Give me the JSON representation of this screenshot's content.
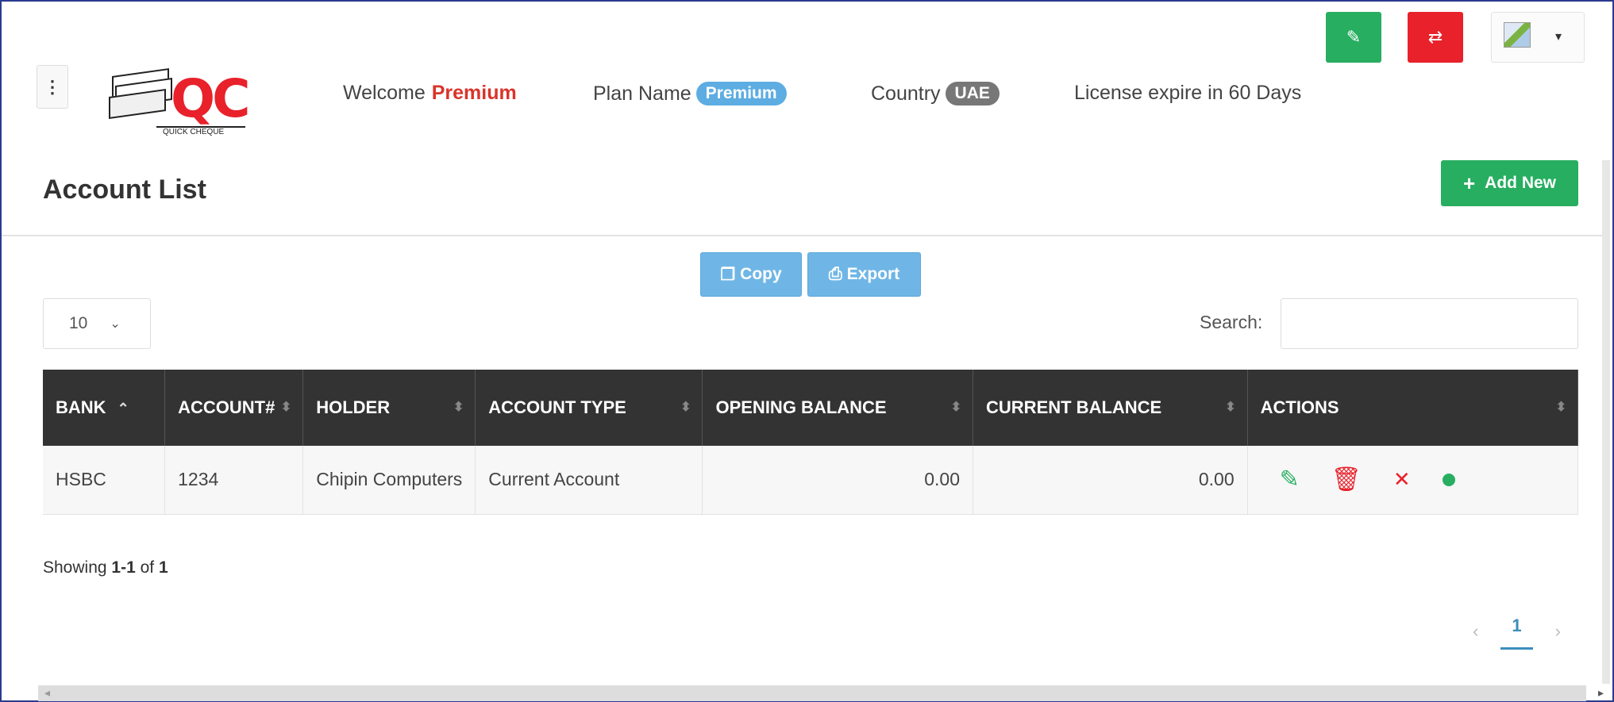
{
  "header": {
    "welcome_label": "Welcome",
    "welcome_name": "Premium",
    "plan_label": "Plan Name",
    "plan_value": "Premium",
    "country_label": "Country",
    "country_value": "UAE",
    "license_text": "License expire in 60 Days",
    "logo_text": "QC",
    "logo_subtext": "QUICK CHEQUE"
  },
  "topbar": {
    "edit_icon": "edit-icon",
    "swap_icon": "swap-icon",
    "avatar": "broken-image-icon"
  },
  "page": {
    "title": "Account List",
    "add_button": "Add New"
  },
  "toolbar": {
    "copy_label": "Copy",
    "export_label": "Export",
    "length_value": "10",
    "search_label": "Search:",
    "search_value": ""
  },
  "table": {
    "columns": [
      "BANK",
      "ACCOUNT#",
      "HOLDER",
      "ACCOUNT TYPE",
      "OPENING BALANCE",
      "CURRENT BALANCE",
      "ACTIONS"
    ],
    "rows": [
      {
        "bank": "HSBC",
        "account": "1234",
        "holder": "Chipin Computers",
        "type": "Current Account",
        "opening": "0.00",
        "current": "0.00"
      }
    ]
  },
  "footer": {
    "showing_prefix": "Showing",
    "showing_range": "1-1",
    "showing_of": "of",
    "showing_total": "1",
    "current_page": "1"
  },
  "colors": {
    "green": "#27ae60",
    "red": "#e8212b",
    "blue_pill": "#5dade2",
    "header_dark": "#333333"
  }
}
